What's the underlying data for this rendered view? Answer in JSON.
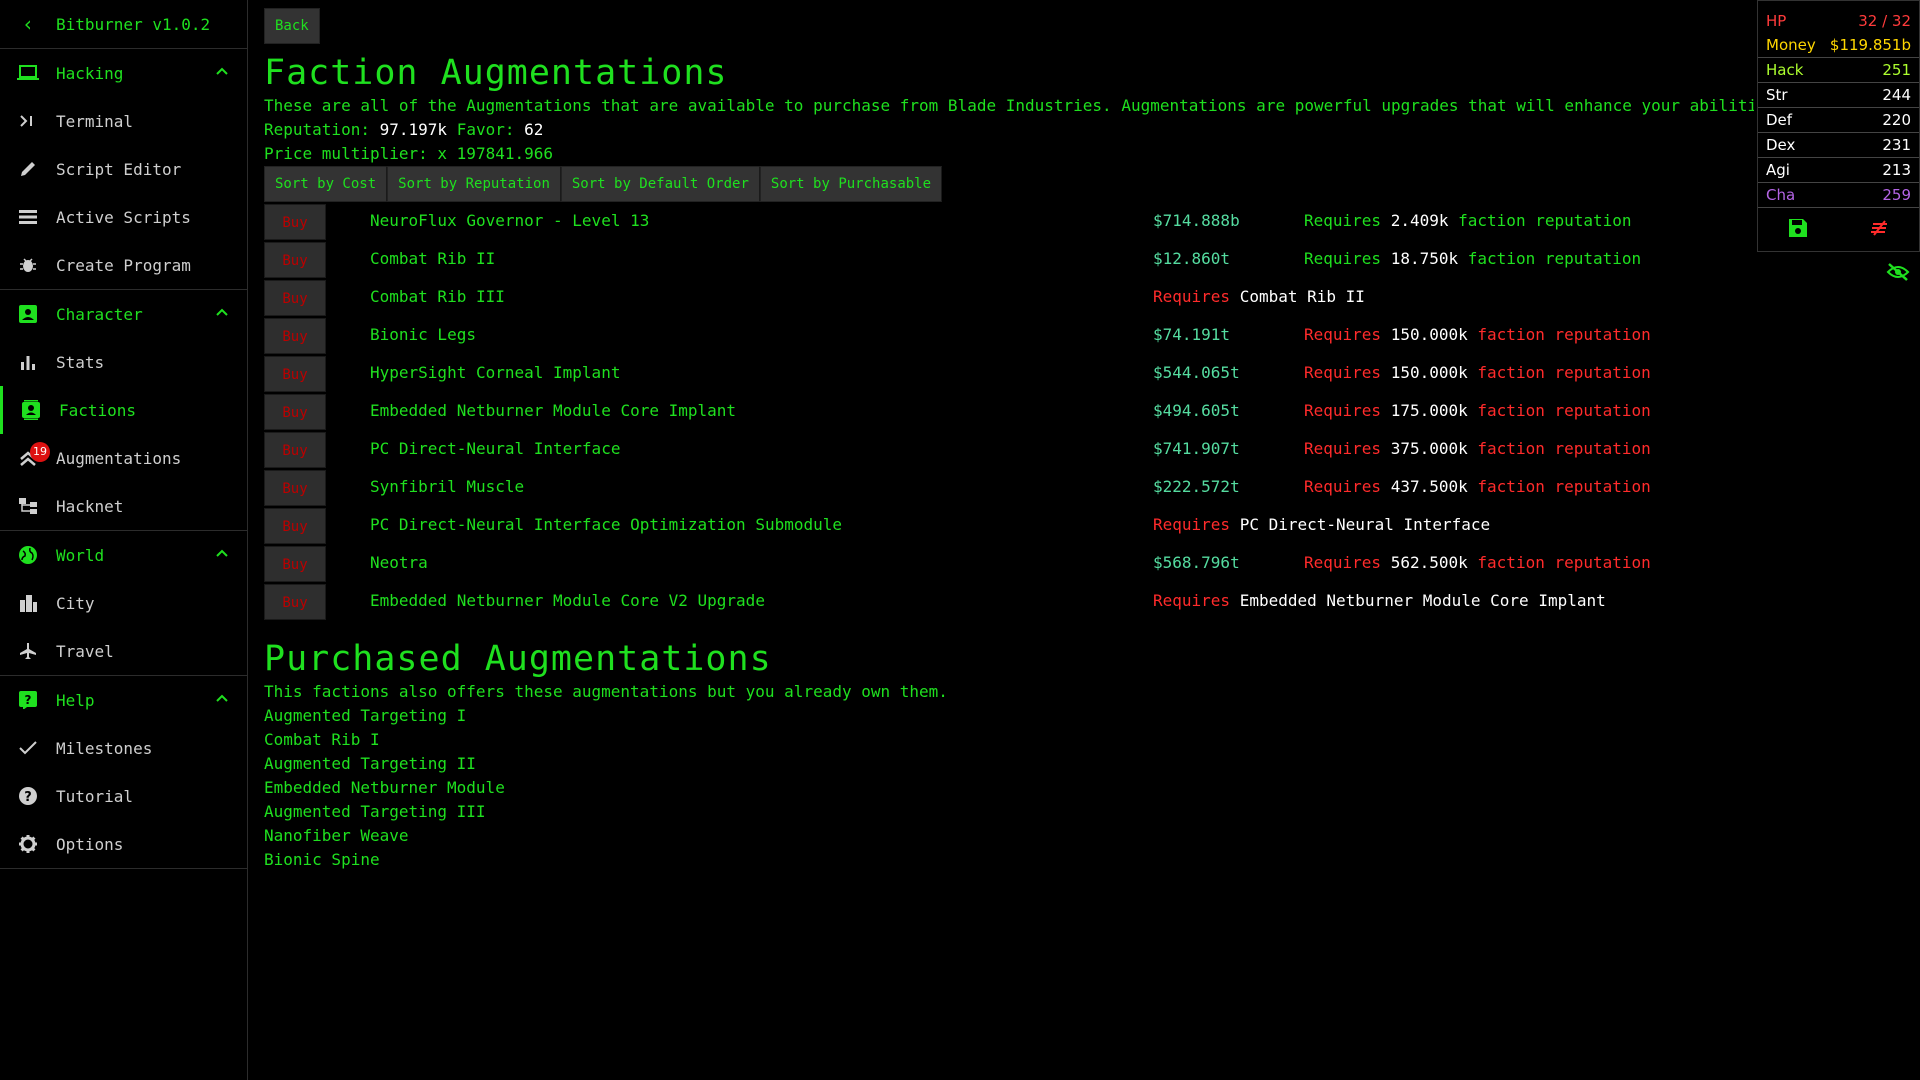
{
  "sidebar": {
    "app_title": "Bitburner v1.0.2",
    "sections": [
      {
        "label": "Hacking",
        "items": [
          {
            "label": "Terminal"
          },
          {
            "label": "Script Editor"
          },
          {
            "label": "Active Scripts"
          },
          {
            "label": "Create Program"
          }
        ]
      },
      {
        "label": "Character",
        "items": [
          {
            "label": "Stats"
          },
          {
            "label": "Factions"
          },
          {
            "label": "Augmentations",
            "badge": "19"
          },
          {
            "label": "Hacknet"
          }
        ]
      },
      {
        "label": "World",
        "items": [
          {
            "label": "City"
          },
          {
            "label": "Travel"
          }
        ]
      },
      {
        "label": "Help",
        "items": [
          {
            "label": "Milestones"
          },
          {
            "label": "Tutorial"
          },
          {
            "label": "Options"
          }
        ]
      }
    ]
  },
  "main": {
    "back_label": "Back",
    "title": "Faction Augmentations",
    "description": "These are all of the Augmentations that are available to purchase from Blade Industries. Augmentations are powerful upgrades that will enhance your abiliti",
    "reputation_label": "Reputation:",
    "reputation_value": "97.197k",
    "favor_label": "Favor:",
    "favor_value": "62",
    "price_mult_label": "Price multiplier: x",
    "price_mult_value": "197841.966",
    "sort_buttons": [
      "Sort by Cost",
      "Sort by Reputation",
      "Sort by Default Order",
      "Sort by Purchasable"
    ],
    "buy_label": "Buy",
    "requires_word": "Requires",
    "faction_rep_word": "faction reputation",
    "augmentations": [
      {
        "name": "NeuroFlux Governor - Level 13",
        "cost": "$714.888b",
        "req_amount": "2.409k",
        "affordable": true
      },
      {
        "name": "Combat Rib II",
        "cost": "$12.860t",
        "req_amount": "18.750k",
        "affordable": true
      },
      {
        "name": "Combat Rib III",
        "cost": "",
        "req_prereq": "Combat Rib II"
      },
      {
        "name": "Bionic Legs",
        "cost": "$74.191t",
        "req_amount": "150.000k",
        "affordable": false
      },
      {
        "name": "HyperSight Corneal Implant",
        "cost": "$544.065t",
        "req_amount": "150.000k",
        "affordable": false
      },
      {
        "name": "Embedded Netburner Module Core Implant",
        "cost": "$494.605t",
        "req_amount": "175.000k",
        "affordable": false
      },
      {
        "name": "PC Direct-Neural Interface",
        "cost": "$741.907t",
        "req_amount": "375.000k",
        "affordable": false
      },
      {
        "name": "Synfibril Muscle",
        "cost": "$222.572t",
        "req_amount": "437.500k",
        "affordable": false
      },
      {
        "name": "PC Direct-Neural Interface Optimization Submodule",
        "cost": "",
        "req_prereq": "PC Direct-Neural Interface"
      },
      {
        "name": "Neotra",
        "cost": "$568.796t",
        "req_amount": "562.500k",
        "affordable": false
      },
      {
        "name": "Embedded Netburner Module Core V2 Upgrade",
        "cost": "",
        "req_prereq": "Embedded Netburner Module Core Implant"
      }
    ],
    "purchased_title": "Purchased Augmentations",
    "purchased_desc": "This factions also offers these augmentations but you already own them.",
    "purchased": [
      "Augmented Targeting I",
      "Combat Rib I",
      "Augmented Targeting II",
      "Embedded Netburner Module",
      "Augmented Targeting III",
      "Nanofiber Weave",
      "Bionic Spine"
    ]
  },
  "overview": {
    "rows": [
      {
        "label": "HP",
        "value": "32 / 32",
        "color": "#ff3b3b"
      },
      {
        "label": "Money",
        "value": "$119.851b",
        "color": "#ffd700"
      },
      {
        "label": "Hack",
        "value": "251",
        "color": "#adff2f"
      },
      {
        "label": "Str",
        "value": "244",
        "color": "#ffffff"
      },
      {
        "label": "Def",
        "value": "220",
        "color": "#ffffff"
      },
      {
        "label": "Dex",
        "value": "231",
        "color": "#ffffff"
      },
      {
        "label": "Agi",
        "value": "213",
        "color": "#ffffff"
      },
      {
        "label": "Cha",
        "value": "259",
        "color": "#b565e6"
      }
    ]
  },
  "colors": {
    "green": "#1fe01f",
    "red": "#ff2b2b",
    "cyan": "#55dca0"
  }
}
